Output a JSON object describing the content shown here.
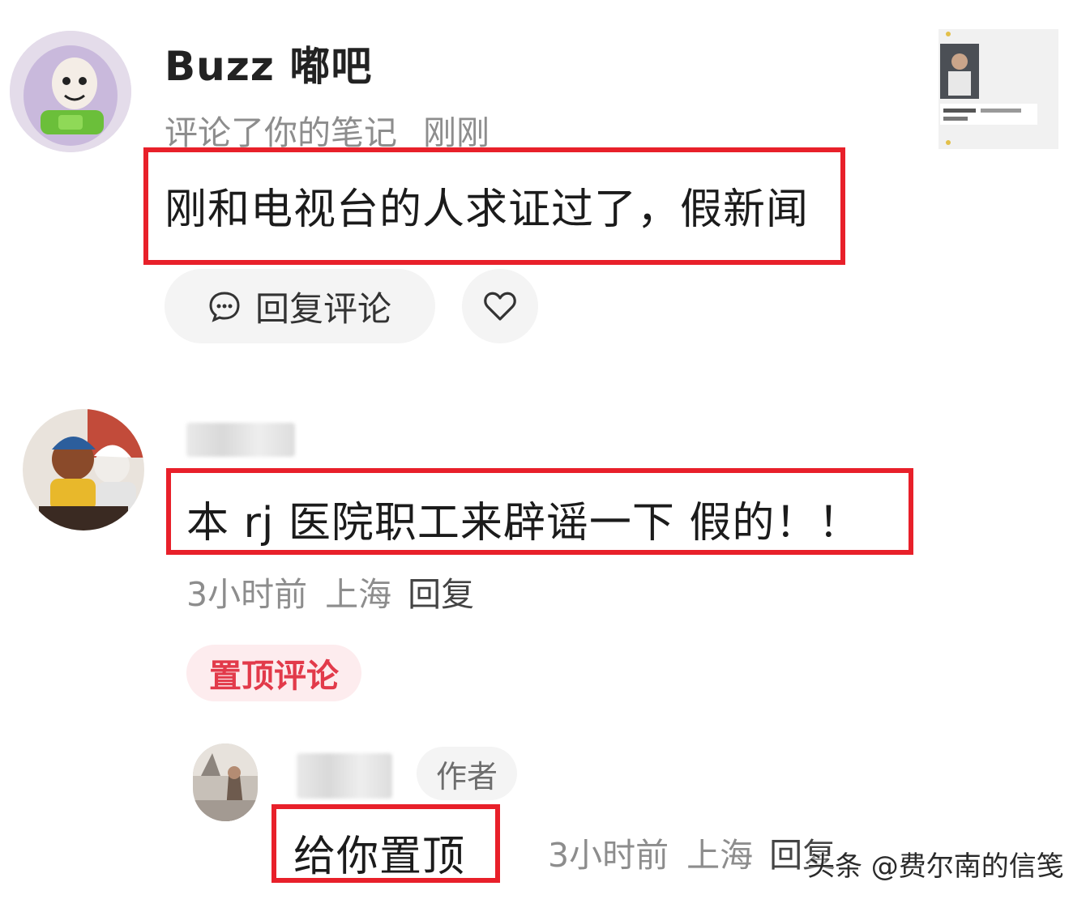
{
  "comment1": {
    "username": "Buzz 嘟吧",
    "action": "评论了你的笔记",
    "time": "刚刚",
    "text": "刚和电视台的人求证过了，假新闻",
    "reply_label": "回复评论"
  },
  "comment2": {
    "text": "本 rj 医院职工来辟谣一下 假的！！",
    "time": "3小时前",
    "location": "上海",
    "reply": "回复",
    "pinned_label": "置顶评论"
  },
  "reply": {
    "author_tag": "作者",
    "text": "给你置顶",
    "time": "3小时前",
    "location": "上海",
    "reply": "回复"
  },
  "watermark": "头条 @费尔南的信笺",
  "colors": {
    "highlight": "#e8202a",
    "pinned_text": "#e23a4a",
    "pinned_bg": "#fdecee",
    "meta": "#8d8d8d"
  }
}
